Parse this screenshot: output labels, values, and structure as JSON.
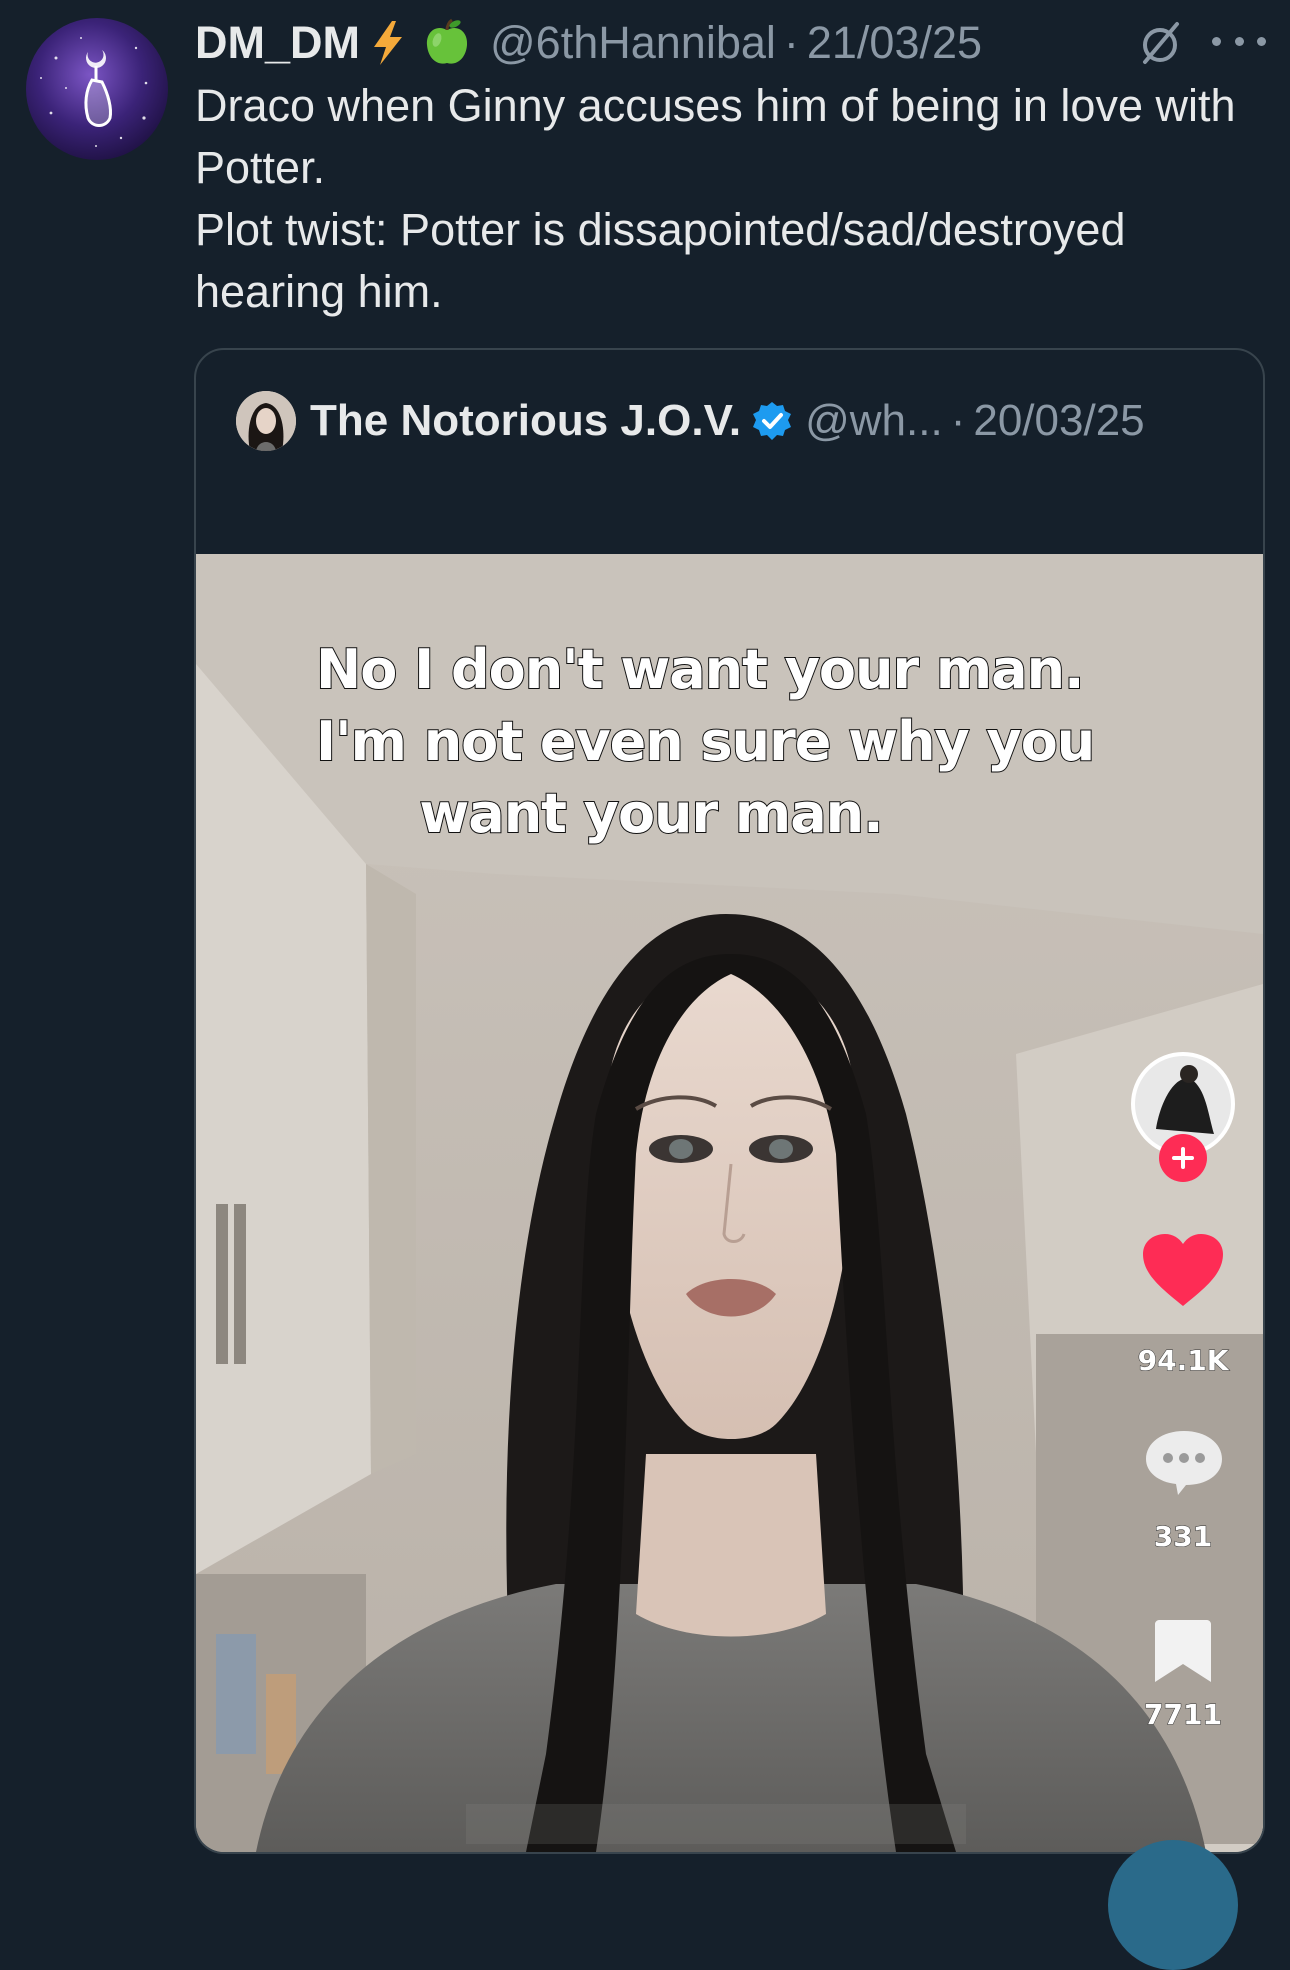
{
  "tweet": {
    "display_name": "DM_DM",
    "badges": [
      "lightning-emoji",
      "green-apple-emoji"
    ],
    "handle": "@6thHannibal",
    "separator": "·",
    "date": "21/03/25",
    "text_line1": "Draco when Ginny accuses him of being in love with Potter.",
    "text_line2": "Plot twist: Potter is dissapointed/sad/destroyed hearing him."
  },
  "quoted_tweet": {
    "display_name": "The Notorious J.O.V.",
    "verified": true,
    "handle": "@wh...",
    "separator": "·",
    "date": "20/03/25",
    "media": {
      "caption_lines": [
        "No I don't want your man.",
        "I'm not even sure why you",
        "want your man."
      ],
      "likes": "94.1K",
      "comments": "331",
      "saves": "7711"
    }
  },
  "colors": {
    "background": "#15202b",
    "text_primary": "#e7e9ea",
    "text_secondary": "#8b98a5",
    "border": "#38444d",
    "verified_blue": "#1d9bf0",
    "tiktok_red": "#fe2c55"
  }
}
